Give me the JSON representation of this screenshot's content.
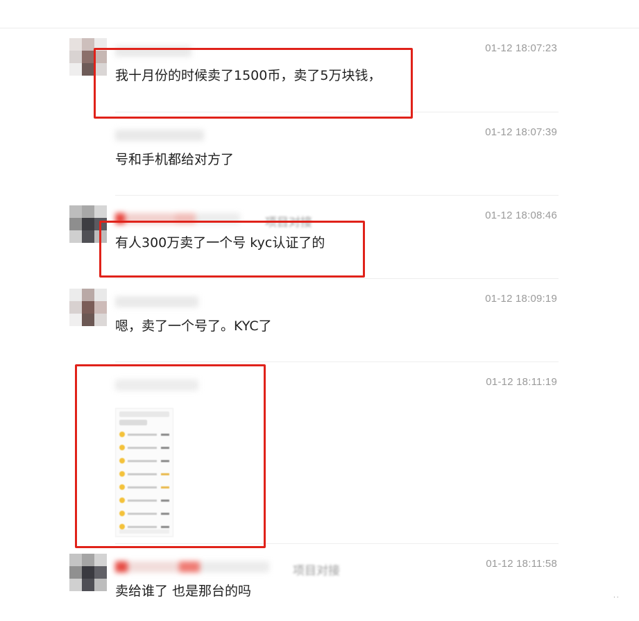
{
  "messages": [
    {
      "id": "m1",
      "time": "01-12 18:07:23",
      "text": "我十月份的时候卖了1500币，卖了5万块钱，",
      "name_suffix": "",
      "highlighted": true
    },
    {
      "id": "m2",
      "time": "01-12 18:07:39",
      "text": "号和手机都给对方了",
      "name_suffix": "",
      "highlighted": false
    },
    {
      "id": "m3",
      "time": "01-12 18:08:46",
      "text": "有人300万卖了一个号 kyc认证了的",
      "name_suffix": "项目对接",
      "highlighted": true
    },
    {
      "id": "m4",
      "time": "01-12 18:09:19",
      "text": "嗯，卖了一个号了。KYC了",
      "name_suffix": "",
      "highlighted": false
    },
    {
      "id": "m5",
      "time": "01-12 18:11:19",
      "text": "",
      "name_suffix": "",
      "highlighted": true,
      "has_image": true
    },
    {
      "id": "m6",
      "time": "01-12 18:11:58",
      "text": "卖给谁了 也是那台的吗",
      "name_suffix": "项目对接",
      "highlighted": false
    }
  ],
  "colors": {
    "highlight": "#e0221a",
    "timestamp": "#9a9a9a",
    "text": "#1f1f1f",
    "coin": "#f4c23a"
  },
  "icons": {
    "attachment_preview": "phone-screenshot-thumbnail"
  }
}
